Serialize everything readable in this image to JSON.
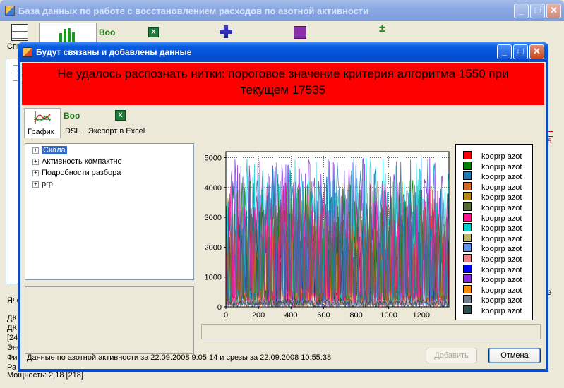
{
  "main_window": {
    "title": "База данных по работе с восстановлением расходов по азотной активности",
    "toolbar": {
      "list_label": "Спи",
      "boo_label": "Boo"
    },
    "side_text": [
      "Яче",
      "ДК",
      "ДК",
      "[24",
      "Эне",
      "Фи",
      "Ра"
    ],
    "bottom_text": "Мощность: 2,18 [218]",
    "right_digits": [
      "5",
      "3"
    ]
  },
  "dialog": {
    "title": "Будут связаны и добавлены данные",
    "error_message": "Не удалось распознать нитки: пороговое значение критерия алгоритма 1550 при текущем 17535",
    "toolbar": {
      "chart_label": "График",
      "dsl_icon_text": "Boo",
      "dsl_label": "DSL",
      "excel_label": "Экспорт в Excel"
    },
    "tree_items": [
      "Скала",
      "Активность компактно",
      "Подробности разбора",
      "prp"
    ],
    "status_text": "Данные по азотной активности за 22.09.2008 9:05:14 и срезы за 22.09.2008 10:55:38",
    "buttons": {
      "add": "Добавить",
      "cancel": "Отмена"
    }
  },
  "chart_data": {
    "type": "line",
    "x": {
      "range": [
        0,
        1370
      ],
      "ticks": [
        0,
        200,
        400,
        600,
        800,
        1000,
        1200
      ]
    },
    "y": {
      "range": [
        0,
        5200
      ],
      "ticks": [
        0,
        1000,
        2000,
        3000,
        4000,
        5000
      ]
    },
    "grid": "dotted",
    "legend_placement": "right",
    "series": [
      {
        "name": "kooprp  azot",
        "color": "#ff0000"
      },
      {
        "name": "kooprp  azot",
        "color": "#008000"
      },
      {
        "name": "kooprp  azot",
        "color": "#1f77b4"
      },
      {
        "name": "kooprp  azot",
        "color": "#d2691e"
      },
      {
        "name": "kooprp  azot",
        "color": "#b8860b"
      },
      {
        "name": "kooprp  azot",
        "color": "#556b2f"
      },
      {
        "name": "kooprp  azot",
        "color": "#ff1493"
      },
      {
        "name": "kooprp  azot",
        "color": "#00ced1"
      },
      {
        "name": "kooprp  azot",
        "color": "#bdb76b"
      },
      {
        "name": "kooprp  azot",
        "color": "#6495ed"
      },
      {
        "name": "kooprp  azot",
        "color": "#f08080"
      },
      {
        "name": "kooprp  azot",
        "color": "#0000ff"
      },
      {
        "name": "kooprp  azot",
        "color": "#8a2be2"
      },
      {
        "name": "kooprp  azot",
        "color": "#ff8c00"
      },
      {
        "name": "kooprp  azot",
        "color": "#708090"
      },
      {
        "name": "kooprp  azot",
        "color": "#2f4f4f"
      }
    ]
  }
}
